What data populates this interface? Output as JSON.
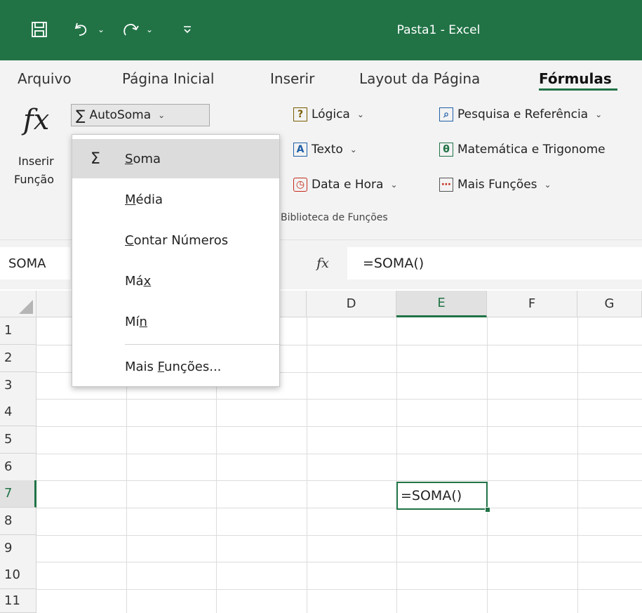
{
  "window": {
    "title": "Pasta1  -  Excel",
    "accent": "#217346"
  },
  "qat": {
    "save_icon": "save-icon",
    "undo_icon": "undo-icon",
    "redo_icon": "redo-icon",
    "customize_icon": "customize-qat-icon"
  },
  "tabs": [
    {
      "label": "Arquivo"
    },
    {
      "label": "Página Inicial"
    },
    {
      "label": "Inserir"
    },
    {
      "label": "Layout da Página"
    },
    {
      "label": "Fórmulas",
      "active": true
    }
  ],
  "ribbon": {
    "insert_function": {
      "icon": "fx",
      "line1": "Inserir",
      "line2": "Função"
    },
    "autosum": {
      "label": "AutoSoma"
    },
    "logica": {
      "label": "Lógica",
      "icon": "?"
    },
    "texto": {
      "label": "Texto",
      "icon": "A"
    },
    "data_hora": {
      "label": "Data e Hora"
    },
    "pesquisa": {
      "label": "Pesquisa e Referência"
    },
    "matematica": {
      "label": "Matemática e Trigonome"
    },
    "mais_funcoes": {
      "label": "Mais Funções"
    },
    "group_label": "Biblioteca de Funções"
  },
  "formula_bar": {
    "name_box": "SOMA",
    "fx": "fx",
    "formula": "=SOMA()"
  },
  "columns": [
    "D",
    "E",
    "F",
    "G"
  ],
  "selected_column": "E",
  "rows": [
    "1",
    "2",
    "3",
    "4",
    "5",
    "6",
    "7",
    "8",
    "9",
    "10",
    "11"
  ],
  "selected_row": "7",
  "active_cell": {
    "ref": "E7",
    "value": "=SOMA()"
  },
  "dropdown": {
    "items": [
      {
        "pre": "",
        "u": "S",
        "post": "oma",
        "highlighted": true,
        "icon": "Σ"
      },
      {
        "pre": "",
        "u": "M",
        "post": "édia"
      },
      {
        "pre": "",
        "u": "C",
        "post": "ontar Números"
      },
      {
        "pre": "Má",
        "u": "x",
        "post": ""
      },
      {
        "pre": "Mí",
        "u": "n",
        "post": ""
      },
      {
        "pre": "Mais ",
        "u": "F",
        "post": "unções..."
      }
    ]
  }
}
